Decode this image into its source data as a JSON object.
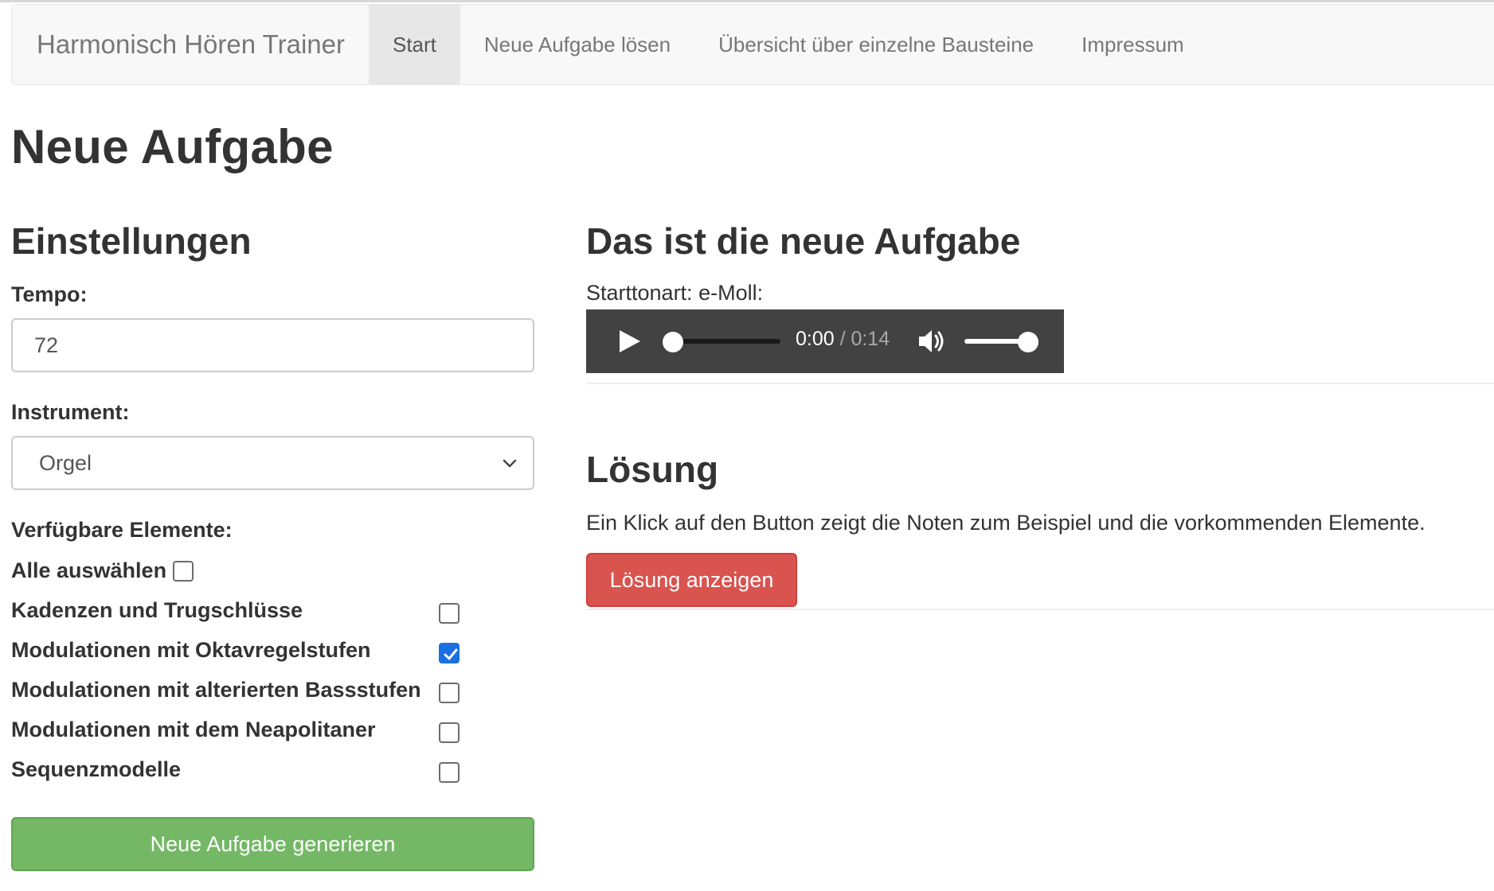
{
  "nav": {
    "brand": "Harmonisch Hören Trainer",
    "items": [
      {
        "label": "Start",
        "active": true
      },
      {
        "label": "Neue Aufgabe lösen",
        "active": false
      },
      {
        "label": "Übersicht über einzelne Bausteine",
        "active": false
      },
      {
        "label": "Impressum",
        "active": false
      }
    ]
  },
  "page_title": "Neue Aufgabe",
  "settings": {
    "heading": "Einstellungen",
    "tempo_label": "Tempo:",
    "tempo_value": "72",
    "instrument_label": "Instrument:",
    "instrument_value": "Orgel",
    "elements_label": "Verfügbare Elemente:",
    "select_all_label": "Alle auswählen",
    "select_all_checked": false,
    "elements": [
      {
        "label": "Kadenzen und Trugschlüsse",
        "checked": false
      },
      {
        "label": "Modulationen mit Oktavregelstufen",
        "checked": true
      },
      {
        "label": "Modulationen mit alterierten Bassstufen",
        "checked": false
      },
      {
        "label": "Modulationen mit dem Neapolitaner",
        "checked": false
      },
      {
        "label": "Sequenzmodelle",
        "checked": false
      }
    ],
    "generate_button": "Neue Aufgabe generieren"
  },
  "task": {
    "heading": "Das ist die neue Aufgabe",
    "key_label": "Starttonart: e-Moll:",
    "audio": {
      "current_time": "0:00",
      "separator": " / ",
      "duration": "0:14",
      "progress": 0.0,
      "volume": 1.0
    }
  },
  "solution": {
    "heading": "Lösung",
    "description": "Ein Klick auf den Button zeigt die Noten zum Beispiel und die vorkommenden Elemente.",
    "button": "Lösung anzeigen"
  },
  "colors": {
    "primary_checkbox": "#1a6fe3",
    "success_button": "#74b866",
    "danger_button": "#d9534f",
    "audio_bg": "#424242"
  }
}
